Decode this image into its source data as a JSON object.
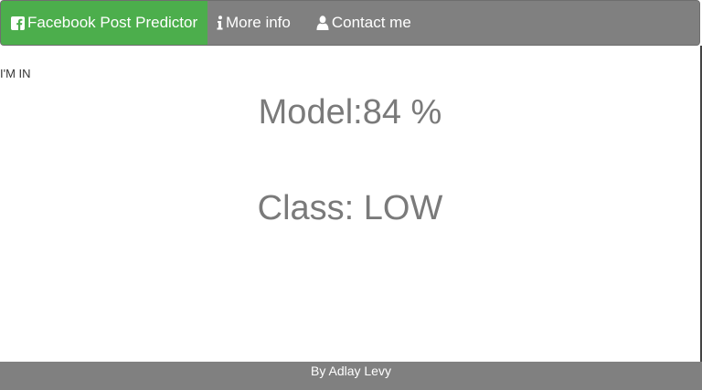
{
  "navbar": {
    "items": [
      {
        "label": "Facebook Post Predictor",
        "icon": "facebook-icon",
        "active": true
      },
      {
        "label": "More info",
        "icon": "info-icon",
        "active": false
      },
      {
        "label": "Contact me",
        "icon": "user-icon",
        "active": false
      }
    ]
  },
  "main": {
    "status": "I'M IN",
    "model": "Model:84 %",
    "class": "Class: LOW"
  },
  "footer": {
    "text": "By Adlay Levy"
  },
  "colors": {
    "navbar_bg": "#808080",
    "brand_bg": "#4cae4c",
    "text_gray": "#7a7a7a"
  }
}
